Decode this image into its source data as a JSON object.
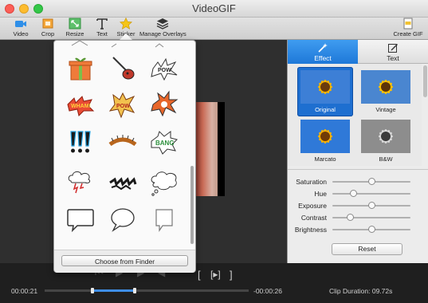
{
  "window": {
    "title": "VideoGIF"
  },
  "toolbar": {
    "video": "Video",
    "crop": "Crop",
    "resize": "Resize",
    "text": "Text",
    "sticker": "Sticker",
    "manage_overlays": "Manage Overlays",
    "create_gif": "Create GIF"
  },
  "sticker_popover": {
    "choose_button": "Choose from Finder",
    "stickers": [
      "gift-box",
      "electric-guitar",
      "pow-splat",
      "wham-burst",
      "pow-burst",
      "splat-burst",
      "exclamation-marks",
      "caterpillar-bones",
      "bang-burst",
      "thunder-cloud",
      "dash-scribble",
      "thought-bubble",
      "speech-bubble-1",
      "speech-bubble-2",
      "speech-bubble-3"
    ]
  },
  "right_panel": {
    "tabs": [
      {
        "label": "Effect",
        "icon": "magic-wand-icon"
      },
      {
        "label": "Text",
        "icon": "pencil-icon"
      }
    ],
    "effects": [
      {
        "label": "Original",
        "selected": true
      },
      {
        "label": "Vintage",
        "selected": false
      },
      {
        "label": "Marcato",
        "selected": false
      },
      {
        "label": "B&W",
        "selected": false
      }
    ],
    "sliders": [
      {
        "label": "Saturation",
        "value": 0.5
      },
      {
        "label": "Hue",
        "value": 0.25
      },
      {
        "label": "Exposure",
        "value": 0.5
      },
      {
        "label": "Contrast",
        "value": 0.2
      },
      {
        "label": "Brightness",
        "value": 0.5
      }
    ],
    "reset": "Reset"
  },
  "playback": {
    "time_start": "00:00:21",
    "time_end": "-00:00:26",
    "clip_duration": "Clip Duration: 09.72s",
    "selection_start": 0.23,
    "selection_end": 0.44
  },
  "colors": {
    "accent": "#1e78d8",
    "selection": "#3f8ee6"
  }
}
